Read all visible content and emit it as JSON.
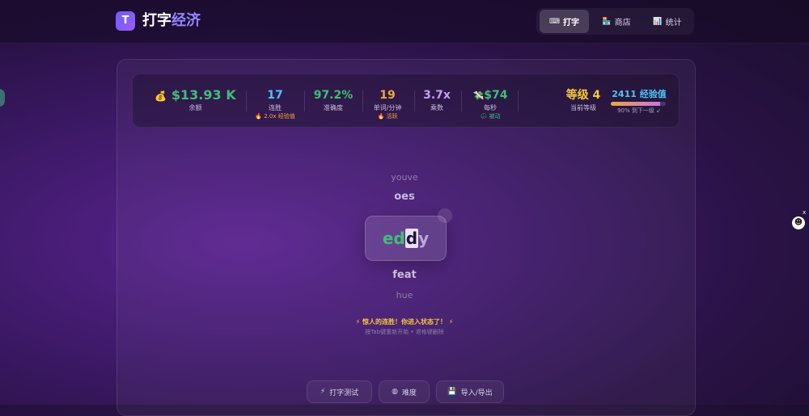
{
  "app": {
    "logo_letter": "T",
    "title_main": "打字",
    "title_accent": "经济"
  },
  "nav": [
    {
      "icon": "⌨",
      "icon_name": "keyboard-icon",
      "label": "打字",
      "active": true
    },
    {
      "icon": "🏪",
      "icon_name": "shop-icon",
      "label": "商店",
      "active": false
    },
    {
      "icon": "📊",
      "icon_name": "stats-icon",
      "label": "统计",
      "active": false
    }
  ],
  "stats": {
    "balance": {
      "icon": "💰",
      "icon_name": "money-bag-icon",
      "value": "$13.93 K",
      "label": "余额"
    },
    "streak": {
      "value": "17",
      "label": "连胜",
      "sub": "🔥 2.0x 经验值"
    },
    "accuracy": {
      "value": "97.2%",
      "label": "准确度"
    },
    "wpm": {
      "value": "19",
      "label": "单词/分钟",
      "sub": "🔥 活跃"
    },
    "multiplier": {
      "value": "3.7x",
      "label": "乘数"
    },
    "per_second": {
      "icon": "💸",
      "icon_name": "money-wings-icon",
      "value": "$74",
      "label": "每秒",
      "sub": "🌧 被动"
    },
    "level": {
      "value": "等级 4",
      "label": "当前等级"
    },
    "xp": {
      "value": "2411 经验值",
      "progress": 0.9,
      "sub": "90% 到下一级 ↙"
    }
  },
  "words": {
    "prev2": "youve",
    "prev1": "oes",
    "current_typed": "ed",
    "current_cursor": "d",
    "current_rest": "y",
    "next1": "feat",
    "next2": "hue"
  },
  "message": {
    "main": "⚡ 惊人的连胜！你进入状态了！ ⚡",
    "hint": "按Tab键重新开始 • 退格键删除"
  },
  "buttons": [
    {
      "icon": "⚡",
      "icon_name": "lightning-icon",
      "label": "打字测试"
    },
    {
      "icon": "◍",
      "icon_name": "difficulty-icon",
      "label": "难度"
    },
    {
      "icon": "💾",
      "icon_name": "save-icon",
      "label": "导入/导出"
    }
  ],
  "colors": {
    "green": "#3fbf74",
    "cyan": "#4fc3f7",
    "orange": "#f0a53b",
    "gold": "#f5c53b",
    "purple": "#c79cf5"
  }
}
